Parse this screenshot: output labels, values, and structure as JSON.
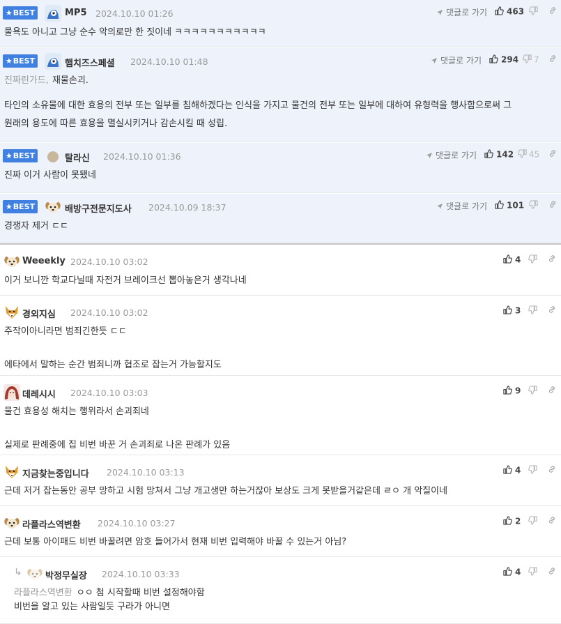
{
  "reply_to_label": "댓글로 가기",
  "best_label": "BEST",
  "best_comments": [
    {
      "nick": "MP5",
      "date": "2024.10.10 01:26",
      "up": "463",
      "down": "",
      "avatar": "blue-bot",
      "lines": [
        "물욕도 아니고 그냥 순수 악의로만 한 짓이네 ㅋㅋㅋㅋㅋㅋㅋㅋㅋㅋㅋ"
      ]
    },
    {
      "nick": "햄치즈스페셜",
      "date": "2024.10.10 01:48",
      "up": "294",
      "down": "7",
      "avatar": "blue-bot",
      "ref": "진짜린가드,",
      "lines": [
        "재물손괴.",
        "",
        "타인의 소유물에 대한 효용의 전부 또는 일부를 침해하겠다는 인식을 가지고 물건의 전부 또는 일부에 대하여 유형력을 행사함으로써 그",
        "원래의 용도에 따른 효용을 멸실시키거나 감손시킬 때 성립."
      ]
    },
    {
      "nick": "탈라신",
      "date": "2024.10.10 01:36",
      "up": "142",
      "down": "45",
      "avatar": "circle",
      "lines": [
        "진짜 이거 사람이 못됐네"
      ]
    },
    {
      "nick": "배방구전문지도사",
      "date": "2024.10.09 18:37",
      "up": "101",
      "down": "",
      "avatar": "dog",
      "lines": [
        "경쟁자 제거 ㄷㄷ"
      ]
    }
  ],
  "comments": [
    {
      "nick": "Weeekly",
      "date": "2024.10.10 03:02",
      "up": "4",
      "avatar": "dog",
      "lines": [
        "이거 보니깐 학교다닐때 자전거 브레이크선 뽑아놓은거 생각나네"
      ]
    },
    {
      "nick": "경외지심",
      "date": "2024.10.10 03:02",
      "up": "3",
      "avatar": "fox",
      "lines": [
        "주작이아니라면 범죄긴한듯 ㄷㄷ",
        "",
        "에타에서 말하는 순간 범죄니까 협조로 잡는거 가능할지도"
      ]
    },
    {
      "nick": "데레시시",
      "date": "2024.10.10 03:03",
      "up": "9",
      "avatar": "redhair",
      "lines": [
        "물건 효용성 해치는 행위라서 손괴죄네",
        "",
        "실제로 판례중에 집 비번 바꾼 거 손괴죄로 나온 판례가 있음"
      ]
    },
    {
      "nick": "지금찾는중입니다",
      "date": "2024.10.10 03:13",
      "up": "4",
      "avatar": "fox",
      "lines": [
        "근데 저거 잡는동안 공부 망하고 시험 망쳐서 그냥 개고생만 하는거잖아 보상도 크게 못받을거같은데 ㄹㅇ 개 악질이네"
      ]
    },
    {
      "nick": "라플라스역변환",
      "date": "2024.10.10 03:27",
      "up": "2",
      "avatar": "dog",
      "lines": [
        "근데 보통 아이패드 비번 바꿀려면 암호 들어가서 현재 비번 입력해야 바꿀 수 있는거 아님?"
      ]
    },
    {
      "nick": "박정무실장",
      "date": "2024.10.10 03:33",
      "up": "4",
      "avatar": "dog-faded",
      "is_reply": true,
      "ref": "라플라스역변환",
      "lines": [
        "ㅇㅇ 첨 시작할때 비번 설정해야함",
        "비번을 알고 있는 사람일듯 구라가 아니면"
      ]
    }
  ]
}
